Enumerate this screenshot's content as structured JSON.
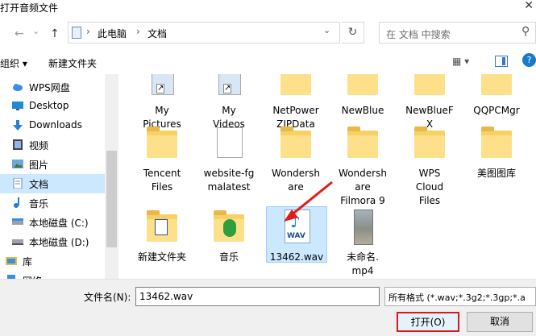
{
  "window": {
    "title": "打开音频文件",
    "close": "✕"
  },
  "nav": {
    "back": "←",
    "forward": "→",
    "recent": "⌄",
    "up": "↑",
    "breadcrumb": [
      "此电脑",
      "文档"
    ],
    "crumb_sep": "›",
    "dropdown": "⌄",
    "refresh": "↻",
    "search_placeholder": "在 文档 中搜索",
    "search_icon": "⚲"
  },
  "toolbar": {
    "organize": "组织 ▾",
    "new_folder": "新建文件夹",
    "view": "▦ ▾",
    "help": "?"
  },
  "sidebar": {
    "items": [
      {
        "label": "WPS网盘",
        "icon": "cloud-icon"
      },
      {
        "label": "Desktop",
        "icon": "desktop-icon"
      },
      {
        "label": "Downloads",
        "icon": "download-icon"
      },
      {
        "label": "视频",
        "icon": "video-icon"
      },
      {
        "label": "图片",
        "icon": "picture-icon"
      },
      {
        "label": "文档",
        "icon": "document-icon",
        "selected": true
      },
      {
        "label": "音乐",
        "icon": "music-icon"
      },
      {
        "label": "本地磁盘 (C:)",
        "icon": "drive-icon"
      },
      {
        "label": "本地磁盘 (D:)",
        "icon": "drive-icon"
      },
      {
        "label": "库",
        "icon": "library-icon"
      },
      {
        "label": "网络",
        "icon": "network-icon"
      }
    ]
  },
  "files": [
    {
      "name": "My\nPictures",
      "type": "shortcut-folder"
    },
    {
      "name": "My\nVideos",
      "type": "shortcut-folder"
    },
    {
      "name": "NetPower\nZIPData",
      "type": "folder"
    },
    {
      "name": "NewBlue",
      "type": "folder"
    },
    {
      "name": "NewBlueF\nX",
      "type": "folder"
    },
    {
      "name": "QQPCMgr",
      "type": "folder"
    },
    {
      "name": "Tencent\nFiles",
      "type": "folder"
    },
    {
      "name": "website-fg\nmalatest",
      "type": "folder"
    },
    {
      "name": "Wondersh\nare",
      "type": "folder"
    },
    {
      "name": "Wondersh\nare\nFilmora 9",
      "type": "folder"
    },
    {
      "name": "WPS\nCloud\nFiles",
      "type": "folder"
    },
    {
      "name": "美图图库",
      "type": "folder"
    },
    {
      "name": "新建文件夹",
      "type": "folder"
    },
    {
      "name": "音乐",
      "type": "folder"
    },
    {
      "name": "13462.wav",
      "type": "wav",
      "selected": true
    },
    {
      "name": "未命名.\nmp4",
      "type": "video"
    }
  ],
  "wav_tag": "WAV",
  "wav_note": "♪",
  "bottom": {
    "filename_label": "文件名(N):",
    "filename_value": "13462.wav",
    "filetype_value": "所有格式 (*.wav;*.3g2;*.3gp;*.a",
    "open": "打开(O)",
    "cancel": "取消"
  },
  "colors": {
    "accent": "#0078d7",
    "selection": "#cce8ff",
    "highlight_red": "#d01d1d"
  }
}
